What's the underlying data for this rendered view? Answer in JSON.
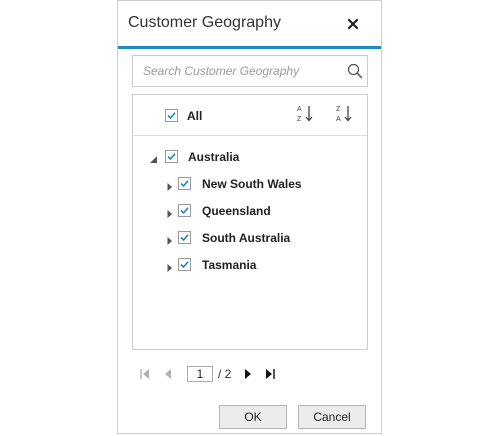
{
  "dialog": {
    "title": "Customer Geography",
    "close_icon": "close-icon"
  },
  "search": {
    "placeholder": "Search Customer Geography",
    "value": "",
    "icon": "search-icon"
  },
  "list": {
    "select_all_label": "All",
    "select_all_checked": true,
    "sort_ascending_icon": "sort-ascending-icon",
    "sort_descending_icon": "sort-descending-icon",
    "root": {
      "label": "Australia",
      "checked": true,
      "expanded": true,
      "children": [
        {
          "label": "New South Wales",
          "checked": true,
          "expanded": false
        },
        {
          "label": "Queensland",
          "checked": true,
          "expanded": false
        },
        {
          "label": "South Australia",
          "checked": true,
          "expanded": false
        },
        {
          "label": "Tasmania",
          "checked": true,
          "expanded": false
        }
      ]
    }
  },
  "pager": {
    "current_page": "1",
    "total_pages": "/ 2"
  },
  "buttons": {
    "ok_label": "OK",
    "cancel_label": "Cancel"
  },
  "colors": {
    "accent": "#1e88c8",
    "check": "#1e88c8"
  }
}
